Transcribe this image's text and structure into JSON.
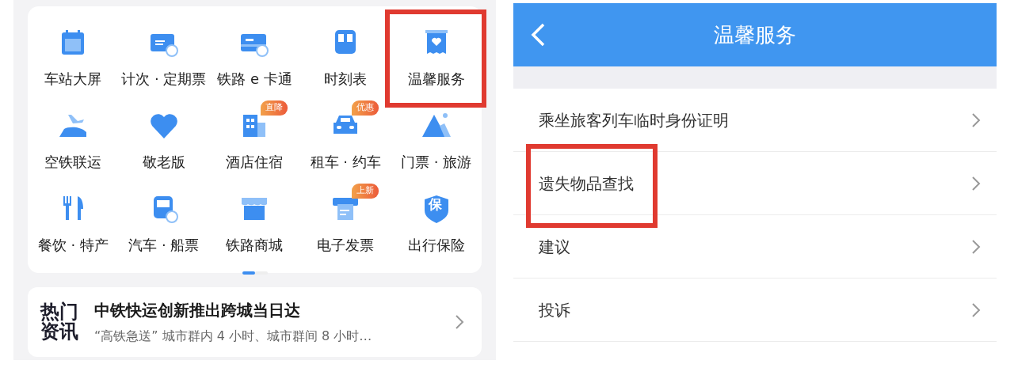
{
  "services": {
    "items": [
      {
        "label": "车站大屏",
        "highlighted": false
      },
      {
        "label": "计次 · 定期票",
        "highlighted": false
      },
      {
        "label": "铁路 e 卡通",
        "highlighted": false
      },
      {
        "label": "时刻表",
        "highlighted": false
      },
      {
        "label": "温馨服务",
        "highlighted": true
      },
      {
        "label": "空铁联运",
        "highlighted": false
      },
      {
        "label": "敬老版",
        "highlighted": false
      },
      {
        "label": "酒店住宿",
        "badge": "直降",
        "highlighted": false
      },
      {
        "label": "租车 · 约车",
        "badge": "优惠",
        "highlighted": false
      },
      {
        "label": "门票 · 旅游",
        "highlighted": false
      },
      {
        "label": "餐饮 · 特产",
        "highlighted": false
      },
      {
        "label": "汽车 · 船票",
        "highlighted": false
      },
      {
        "label": "铁路商城",
        "highlighted": false
      },
      {
        "label": "电子发票",
        "badge": "上新",
        "highlighted": false
      },
      {
        "label": "出行保险",
        "icon_text": "保",
        "highlighted": false
      }
    ],
    "pages": [
      {
        "selected": true
      },
      {
        "selected": false
      }
    ]
  },
  "news": {
    "label_lines": [
      "热门",
      "资讯"
    ],
    "headline": "中铁快运创新推出跨城当日达",
    "summary": "“高铁急送” 城市群内 4 小时、城市群间 8 小时…"
  },
  "detail": {
    "title": "温馨服务",
    "items": [
      {
        "label": "乘坐旅客列车临时身份证明",
        "highlighted": false
      },
      {
        "label": "遗失物品查找",
        "highlighted": true
      },
      {
        "label": "建议",
        "highlighted": false
      },
      {
        "label": "投诉",
        "highlighted": false
      }
    ]
  }
}
